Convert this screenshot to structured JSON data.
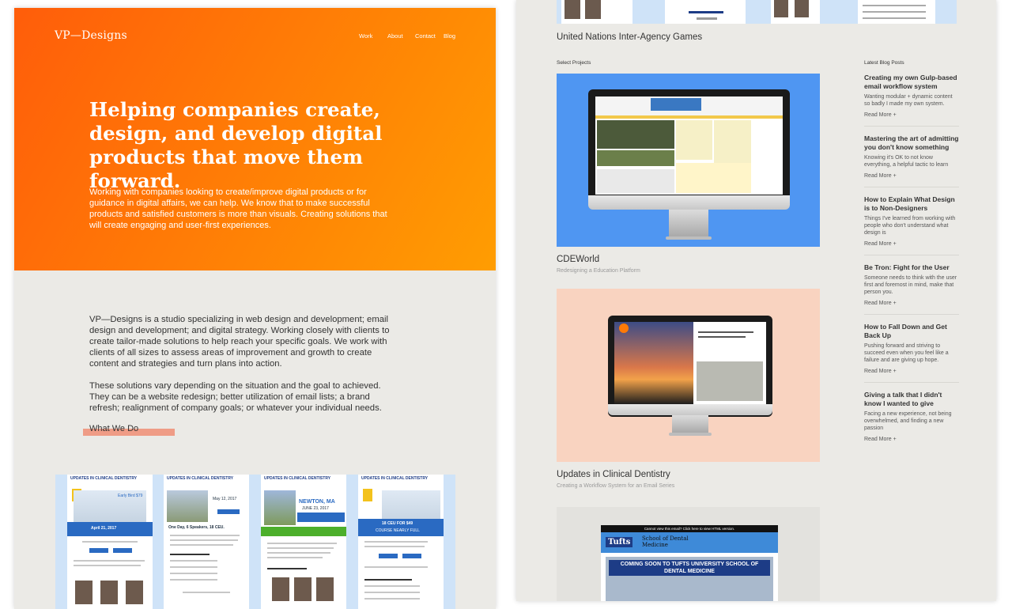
{
  "left": {
    "logo": "VP—Designs",
    "nav": [
      "Work",
      "About",
      "Contact",
      "Blog"
    ],
    "headline": "Helping companies create, design, and develop digital products that move them forward.",
    "hero_text": "Working with companies looking to create/improve digital products or for guidance in digital affairs, we can help. We know that to make successful products and satisfied customers is more than visuals. Creating solutions that will create engaging and user-first experiences.",
    "about_p1": "VP—Designs is a studio specializing in web design and development; email design and development; and digital strategy. Working closely with clients to create tailor-made solutions to help reach your specific goals. We work with clients of all sizes to assess areas of improvement and growth to create content and strategies and turn plans into action.",
    "about_p2": "These solutions vary depending on the situation and the goal to achieved. They can be a website redesign; better utilization of email lists; a brand refresh; realignment of company goals; or whatever your individual needs.",
    "what_we_do": "What We Do",
    "emails": [
      {
        "header": "UPDATES IN CLINICAL DENTISTRY",
        "tag": "Early Bird $79",
        "date": "April 21, 2017"
      },
      {
        "header": "UPDATES IN CLINICAL DENTISTRY",
        "tag": "May 12, 2017",
        "date": "One Day, 6 Speakers, 18 CEU."
      },
      {
        "header": "UPDATES IN CLINICAL DENTISTRY",
        "tag": "NEWTON, MA",
        "date": "JUNE 23, 2017"
      },
      {
        "header": "UPDATES IN CLINICAL DENTISTRY",
        "tag": "18 CEU FOR $49",
        "date": "COURSE NEARLY FULL"
      }
    ]
  },
  "right": {
    "top_project_title": "United Nations Inter-Agency Games",
    "select_projects_label": "Select Projects",
    "blog_label": "Latest Blog Posts",
    "projects": [
      {
        "title": "CDEWorld",
        "subtitle": "Redesigning a Education Platform",
        "bg": "#4f96f2"
      },
      {
        "title": "Updates in Clinical Dentistry",
        "subtitle": "Creating a Workflow System for an Email Series",
        "bg": "#f9d3c0"
      },
      {
        "title": "",
        "subtitle": "",
        "bg": "#e3e2de"
      }
    ],
    "third_email": {
      "top": "Cannot view this email? Click here to view HTML version.",
      "brand": "Tufts",
      "brand_sub": "School of Dental Medicine",
      "banner": "COMING SOON TO TUFTS UNIVERSITY SCHOOL OF DENTAL MEDICINE"
    },
    "posts": [
      {
        "title": "Creating my own Gulp-based email workflow system",
        "excerpt": "Wanting modular + dynamic content so badly I made my own system.",
        "more": "Read More +"
      },
      {
        "title": "Mastering the art of admitting you don't know something",
        "excerpt": "Knowing it's OK to not know everything, a helpful tactic to learn",
        "more": "Read More +"
      },
      {
        "title": "How to Explain What Design is to Non-Designers",
        "excerpt": "Things I've learned from working with people who don't understand what design is",
        "more": "Read More +"
      },
      {
        "title": "Be Tron: Fight for the User",
        "excerpt": "Someone needs to think with the user first and foremost in mind, make that person you.",
        "more": "Read More +"
      },
      {
        "title": "How to Fall Down and Get Back Up",
        "excerpt": "Pushing forward and striving to succeed even when you feel like a failure and are giving up hope.",
        "more": "Read More +"
      },
      {
        "title": "Giving a talk that I didn't know I wanted to give",
        "excerpt": "Facing a new experience, not being overwhelmed, and finding a new passion",
        "more": "Read More +"
      }
    ]
  }
}
